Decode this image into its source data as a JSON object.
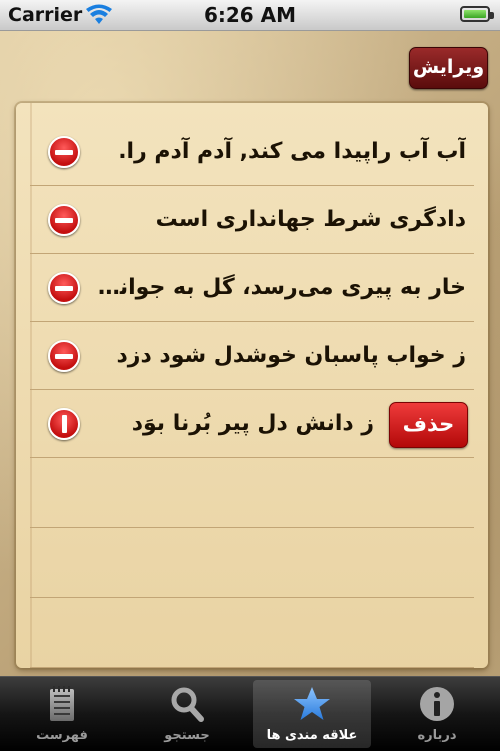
{
  "status_bar": {
    "carrier": "Carrier",
    "time": "6:26 AM"
  },
  "toolbar": {
    "edit_label": "ویرایش"
  },
  "favorites": [
    {
      "text": "آب آب راپیدا  می کند, آدم آدم را.",
      "delete_visible": false
    },
    {
      "text": "دادگری شرط جهانداری است",
      "delete_visible": false
    },
    {
      "text": "خار به پیری می‌رسد، گل به جوانی م...",
      "delete_visible": false
    },
    {
      "text": "ز خواب پاسبان خوشدل شود دزد",
      "delete_visible": false
    },
    {
      "text": "ز دانش دل پیر بُرنا بوَد",
      "delete_visible": true,
      "delete_label": "حذف"
    }
  ],
  "tabbar": {
    "tabs": [
      {
        "label": "فهرست",
        "icon": "list-icon",
        "selected": false
      },
      {
        "label": "جستجو",
        "icon": "search-icon",
        "selected": false
      },
      {
        "label": "علاقه مندی ها",
        "icon": "star-icon",
        "selected": true
      },
      {
        "label": "درباره",
        "icon": "info-icon",
        "selected": false
      }
    ]
  },
  "colors": {
    "accent": "#7a1414",
    "delete": "#d61d1d",
    "tab_selected": "#3f8de8"
  }
}
